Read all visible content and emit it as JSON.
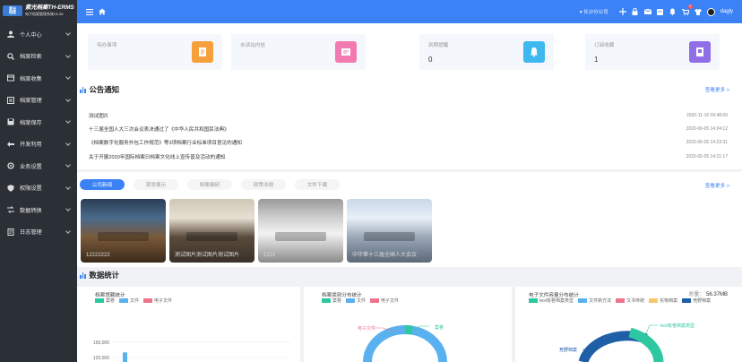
{
  "brand": {
    "logo_top": "紫光",
    "logo_bottom": "档案",
    "title": "紫光档案TH-ERMS",
    "subtitle": "电子档案管理系统V6.36"
  },
  "sidebar": {
    "items": [
      {
        "label": "个人中心",
        "icon": "person-icon"
      },
      {
        "label": "档案检索",
        "icon": "search-icon"
      },
      {
        "label": "档案收集",
        "icon": "collect-icon"
      },
      {
        "label": "档案管理",
        "icon": "manage-icon"
      },
      {
        "label": "档案保存",
        "icon": "save-icon"
      },
      {
        "label": "开发利用",
        "icon": "develop-icon"
      },
      {
        "label": "业务设置",
        "icon": "business-settings-icon"
      },
      {
        "label": "权限设置",
        "icon": "permission-icon"
      },
      {
        "label": "数据转换",
        "icon": "convert-icon"
      },
      {
        "label": "日志管理",
        "icon": "log-icon"
      }
    ]
  },
  "topbar": {
    "company": "长沙分公司",
    "username": "dagly",
    "notify_count": "0"
  },
  "stats": [
    {
      "label": "待办事项",
      "value": "",
      "color": "#f5a03c",
      "icon": "todo-icon"
    },
    {
      "label": "未读站内信",
      "value": "",
      "color": "#f27ab0",
      "icon": "mail-icon"
    },
    {
      "label": "到期提醒",
      "value": "0",
      "color": "#3fb8f0",
      "icon": "bell-icon"
    },
    {
      "label": "订阅收藏",
      "value": "1",
      "color": "#8f6ee6",
      "icon": "favorite-icon"
    }
  ],
  "notices": {
    "title": "公告通知",
    "more": "查看更多 >",
    "items": [
      {
        "text": "测试图片",
        "date": "2020-11-16 09:48:09"
      },
      {
        "text": "十三届全国人大三次会议表决通过了《中华人民共和国民法典》",
        "date": "2020-06-05 14:24:12"
      },
      {
        "text": "《档案数字化服务外包工作规范》等3项档案行业标准项目意见的通知",
        "date": "2020-06-05 14:23:31"
      },
      {
        "text": "关于开展2020年国际档案日档案文化线上宣传普及活动的通知",
        "date": "2020-06-05 14:21:17"
      }
    ]
  },
  "tabs": {
    "items": [
      "公司新闻",
      "荣誉展示",
      "档案编研",
      "政策法规",
      "文件下载"
    ],
    "active": 0,
    "more": "查看更多 >"
  },
  "photos": [
    {
      "caption": "12222222"
    },
    {
      "caption": "测试图片测试图片测试图片"
    },
    {
      "caption": "1222"
    },
    {
      "caption": "中华第十三届全国人大会议"
    }
  ],
  "stats_section": {
    "title": "数据统计"
  },
  "chart_data": [
    {
      "type": "bar",
      "title": "档案馆藏统计",
      "series": [
        {
          "name": "案卷",
          "color": "#2ec8a0"
        },
        {
          "name": "文件",
          "color": "#5ab1ef"
        },
        {
          "name": "电子文件",
          "color": "#f0738c"
        }
      ],
      "y_ticks": [
        "150,000",
        "120,000",
        "90,000"
      ],
      "ylim": [
        0,
        150000
      ],
      "partial_bar": {
        "series": "文件",
        "value": 130000
      }
    },
    {
      "type": "pie",
      "title": "档案类别分布统计",
      "series": [
        {
          "name": "案卷",
          "color": "#2ec8a0"
        },
        {
          "name": "文件",
          "color": "#5ab1ef"
        },
        {
          "name": "电子文件",
          "color": "#f0738c"
        }
      ],
      "labels": [
        "电子文件",
        "案卷"
      ]
    },
    {
      "type": "pie",
      "title": "电子文件容量分布统计",
      "total_label": "总量：",
      "total_value": "56.37MB",
      "series": [
        {
          "name": "test有卷档案类型",
          "color": "#2ec8a0"
        },
        {
          "name": "文件新方法",
          "color": "#5ab1ef"
        },
        {
          "name": "文书传统",
          "color": "#f0738c"
        },
        {
          "name": "实物档案",
          "color": "#f7c76b"
        },
        {
          "name": "竞野档案",
          "color": "#1f5fa8"
        }
      ],
      "labels": [
        "test有卷档案类型",
        "竞野档案"
      ]
    }
  ]
}
